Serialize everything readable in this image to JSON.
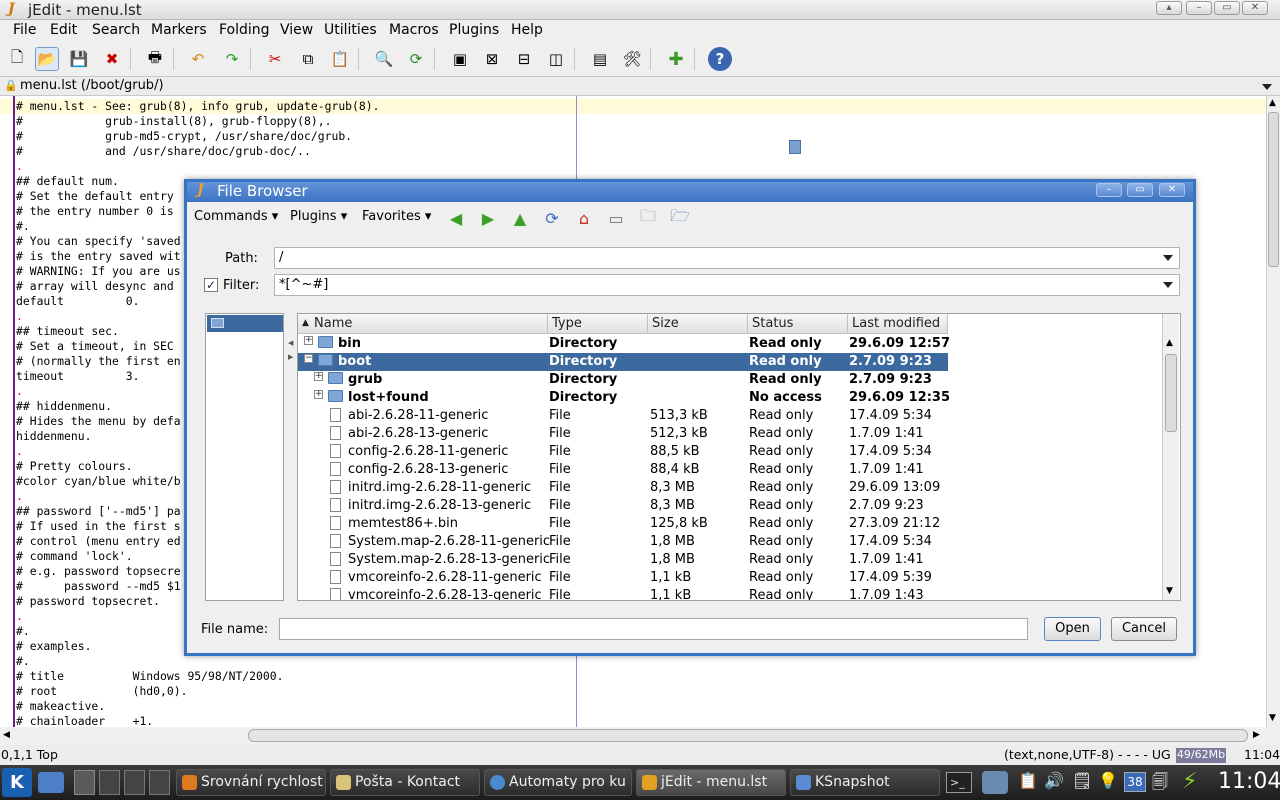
{
  "window": {
    "title": "jEdit - menu.lst"
  },
  "menubar": [
    "File",
    "Edit",
    "Search",
    "Markers",
    "Folding",
    "View",
    "Utilities",
    "Macros",
    "Plugins",
    "Help"
  ],
  "buffer": {
    "name": "menu.lst (/boot/grub/)"
  },
  "editor": {
    "lines": [
      "# menu.lst - See: grub(8), info grub, update-grub(8).",
      "#            grub-install(8), grub-floppy(8),.",
      "#            grub-md5-crypt, /usr/share/doc/grub.",
      "#            and /usr/share/doc/grub-doc/..",
      ".",
      "## default num.",
      "# Set the default entry",
      "# the entry number 0 is",
      "#.",
      "# You can specify 'saved",
      "# is the entry saved wit",
      "# WARNING: If you are us",
      "# array will desync and",
      "default         0.",
      ".",
      "## timeout sec.",
      "# Set a timeout, in SEC",
      "# (normally the first en",
      "timeout         3.",
      ".",
      "## hiddenmenu.",
      "# Hides the menu by defa",
      "hiddenmenu.",
      ".",
      "# Pretty colours.",
      "#color cyan/blue white/b",
      ".",
      "## password ['--md5'] pa",
      "# If used in the first s",
      "# control (menu entry ed",
      "# command 'lock'.",
      "# e.g. password topsecre",
      "#      password --md5 $1",
      "# password topsecret.",
      ".",
      "#.",
      "# examples.",
      "#.",
      "# title          Windows 95/98/NT/2000.",
      "# root           (hd0,0).",
      "# makeactive.",
      "# chainloader    +1."
    ]
  },
  "status": {
    "left": "0,1,1 Top",
    "right": "(text,none,UTF-8) - - - - UG",
    "memory": "49/62Mb",
    "time": "11:04"
  },
  "dialog": {
    "title": "File Browser",
    "menus": [
      "Commands",
      "Plugins",
      "Favorites"
    ],
    "path_label": "Path:",
    "path_value": "/",
    "filter_label": "Filter:",
    "filter_value": "*[^~#]",
    "filter_checked": true,
    "columns": [
      "Name",
      "Type",
      "Size",
      "Status",
      "Last modified"
    ],
    "rows": [
      {
        "name": "bin",
        "type": "Directory",
        "size": "",
        "status": "Read only",
        "modified": "29.6.09 12:57",
        "kind": "dir",
        "indent": 0,
        "expander": "+",
        "selected": false
      },
      {
        "name": "boot",
        "type": "Directory",
        "size": "",
        "status": "Read only",
        "modified": "2.7.09 9:23",
        "kind": "dir",
        "indent": 0,
        "expander": "−",
        "selected": true
      },
      {
        "name": "grub",
        "type": "Directory",
        "size": "",
        "status": "Read only",
        "modified": "2.7.09 9:23",
        "kind": "dir",
        "indent": 1,
        "expander": "+",
        "selected": false
      },
      {
        "name": "lost+found",
        "type": "Directory",
        "size": "",
        "status": "No access",
        "modified": "29.6.09 12:35",
        "kind": "dir",
        "indent": 1,
        "expander": "+",
        "selected": false
      },
      {
        "name": "abi-2.6.28-11-generic",
        "type": "File",
        "size": "513,3 kB",
        "status": "Read only",
        "modified": "17.4.09 5:34",
        "kind": "file",
        "indent": 1,
        "selected": false
      },
      {
        "name": "abi-2.6.28-13-generic",
        "type": "File",
        "size": "512,3 kB",
        "status": "Read only",
        "modified": "1.7.09 1:41",
        "kind": "file",
        "indent": 1,
        "selected": false
      },
      {
        "name": "config-2.6.28-11-generic",
        "type": "File",
        "size": "88,5 kB",
        "status": "Read only",
        "modified": "17.4.09 5:34",
        "kind": "file",
        "indent": 1,
        "selected": false
      },
      {
        "name": "config-2.6.28-13-generic",
        "type": "File",
        "size": "88,4 kB",
        "status": "Read only",
        "modified": "1.7.09 1:41",
        "kind": "file",
        "indent": 1,
        "selected": false
      },
      {
        "name": "initrd.img-2.6.28-11-generic",
        "type": "File",
        "size": "8,3 MB",
        "status": "Read only",
        "modified": "29.6.09 13:09",
        "kind": "file",
        "indent": 1,
        "selected": false
      },
      {
        "name": "initrd.img-2.6.28-13-generic",
        "type": "File",
        "size": "8,3 MB",
        "status": "Read only",
        "modified": "2.7.09 9:23",
        "kind": "file",
        "indent": 1,
        "selected": false
      },
      {
        "name": "memtest86+.bin",
        "type": "File",
        "size": "125,8 kB",
        "status": "Read only",
        "modified": "27.3.09 21:12",
        "kind": "file",
        "indent": 1,
        "selected": false
      },
      {
        "name": "System.map-2.6.28-11-generic",
        "type": "File",
        "size": "1,8 MB",
        "status": "Read only",
        "modified": "17.4.09 5:34",
        "kind": "file",
        "indent": 1,
        "selected": false
      },
      {
        "name": "System.map-2.6.28-13-generic",
        "type": "File",
        "size": "1,8 MB",
        "status": "Read only",
        "modified": "1.7.09 1:41",
        "kind": "file",
        "indent": 1,
        "selected": false
      },
      {
        "name": "vmcoreinfo-2.6.28-11-generic",
        "type": "File",
        "size": "1,1 kB",
        "status": "Read only",
        "modified": "17.4.09 5:39",
        "kind": "file",
        "indent": 1,
        "selected": false
      },
      {
        "name": "vmcoreinfo-2.6.28-13-generic",
        "type": "File",
        "size": "1,1 kB",
        "status": "Read only",
        "modified": "1.7.09 1:43",
        "kind": "file",
        "indent": 1,
        "selected": false
      }
    ],
    "filename_label": "File name:",
    "filename_value": "",
    "open_label": "Open",
    "cancel_label": "Cancel"
  },
  "taskbar": {
    "tasks": [
      {
        "label": "Srovnání rychlost",
        "icon": "firefox-icon",
        "color": "#e07a20"
      },
      {
        "label": "Pošta - Kontact",
        "icon": "mail-icon",
        "color": "#d9c27a"
      },
      {
        "label": "Automaty pro ku",
        "icon": "konqueror-icon",
        "color": "#4a8ad0"
      },
      {
        "label": "jEdit - menu.lst",
        "icon": "jedit-icon",
        "color": "#e0a020"
      },
      {
        "label": "KSnapshot",
        "icon": "camera-icon",
        "color": "#5a8ad0"
      }
    ],
    "tray_badge": "38",
    "clock": "11:04"
  }
}
